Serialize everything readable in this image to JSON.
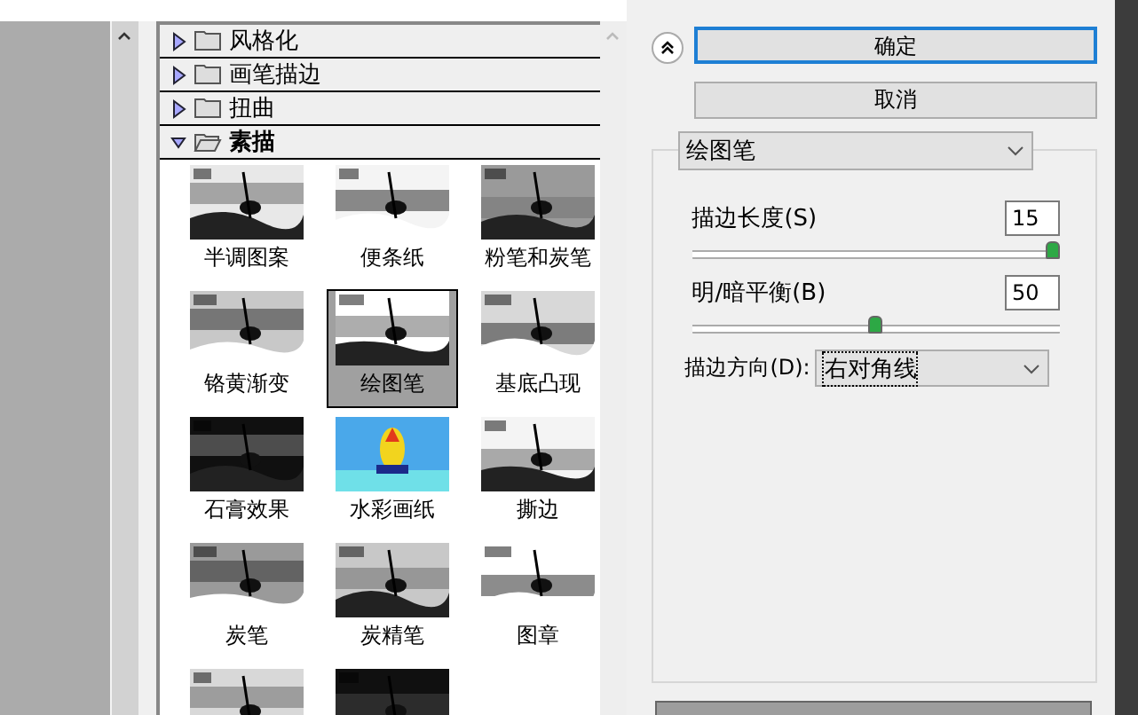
{
  "filter_gallery": {
    "categories": [
      {
        "name": "风格化",
        "expanded": false
      },
      {
        "name": "画笔描边",
        "expanded": false
      },
      {
        "name": "扭曲",
        "expanded": false
      },
      {
        "name": "素描",
        "expanded": true
      }
    ],
    "filters": [
      {
        "label": "半调图案",
        "selected": false
      },
      {
        "label": "便条纸",
        "selected": false
      },
      {
        "label": "粉笔和炭笔",
        "selected": false
      },
      {
        "label": "铬黄渐变",
        "selected": false
      },
      {
        "label": "绘图笔",
        "selected": true
      },
      {
        "label": "基底凸现",
        "selected": false
      },
      {
        "label": "石膏效果",
        "selected": false
      },
      {
        "label": "水彩画纸",
        "selected": false
      },
      {
        "label": "撕边",
        "selected": false
      },
      {
        "label": "炭笔",
        "selected": false
      },
      {
        "label": "炭精笔",
        "selected": false
      },
      {
        "label": "图章",
        "selected": false
      },
      {
        "selected": false
      },
      {
        "selected": false
      }
    ]
  },
  "buttons": {
    "ok": "确定",
    "cancel": "取消"
  },
  "settings": {
    "filter": "绘图笔",
    "sliders": [
      {
        "label": "描边长度(S)",
        "value": "15",
        "level": 1
      },
      {
        "label": "明/暗平衡(B)",
        "value": "50",
        "level": 0.5
      }
    ],
    "direction": {
      "label": "描边方向(D):",
      "value": "右对角线"
    }
  }
}
